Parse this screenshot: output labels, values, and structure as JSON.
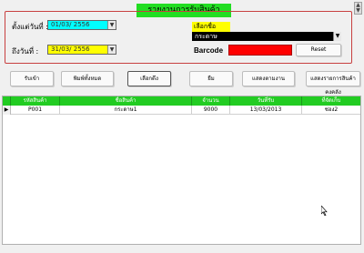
{
  "window": {
    "title": "รายงานการรับสินค้า"
  },
  "filters": {
    "from_label": "ตั้งแต่วันที่ :",
    "from_value": "01/03/ 2556",
    "to_label": "ถึงวันที่ :",
    "to_value": "31/03/ 2556",
    "product_label": "เลือกชื่อสินค้า",
    "product_value": "กระดาษ",
    "barcode_label": "Barcode",
    "barcode_value": "",
    "reset_label": "Reset",
    "dropdown_glyph": "▼"
  },
  "toolbar": {
    "buttons": [
      {
        "label": "รับเข้า"
      },
      {
        "label": "พิมพ์ทั้งหมด"
      },
      {
        "label": "เลือกดึง"
      },
      {
        "label": "ยืม"
      },
      {
        "label": "แสดงตามงาน"
      },
      {
        "label": "แสดงรายการสินค้าคงคลัง"
      }
    ]
  },
  "grid": {
    "columns": [
      "รหัสสินค้า",
      "ชื่อสินค้า",
      "จำนวน",
      "วันที่รับ",
      "ที่จัดเก็บ"
    ],
    "rows": [
      {
        "indicator": "▶",
        "cells": [
          "P001",
          "กระดาษ1",
          "9000",
          "13/03/2013",
          "ช่อง2"
        ]
      }
    ]
  },
  "scroll_glyphs": {
    "up": "▲",
    "down": "▼"
  },
  "colors": {
    "title_bg": "#22dd22",
    "grid_header_bg": "#22cc22",
    "from_date_bg": "#00ffff",
    "to_date_bg": "#ffff00",
    "product_label_bg": "#ffff00",
    "product_select_bg": "#000000",
    "barcode_bg": "#ff0000"
  }
}
